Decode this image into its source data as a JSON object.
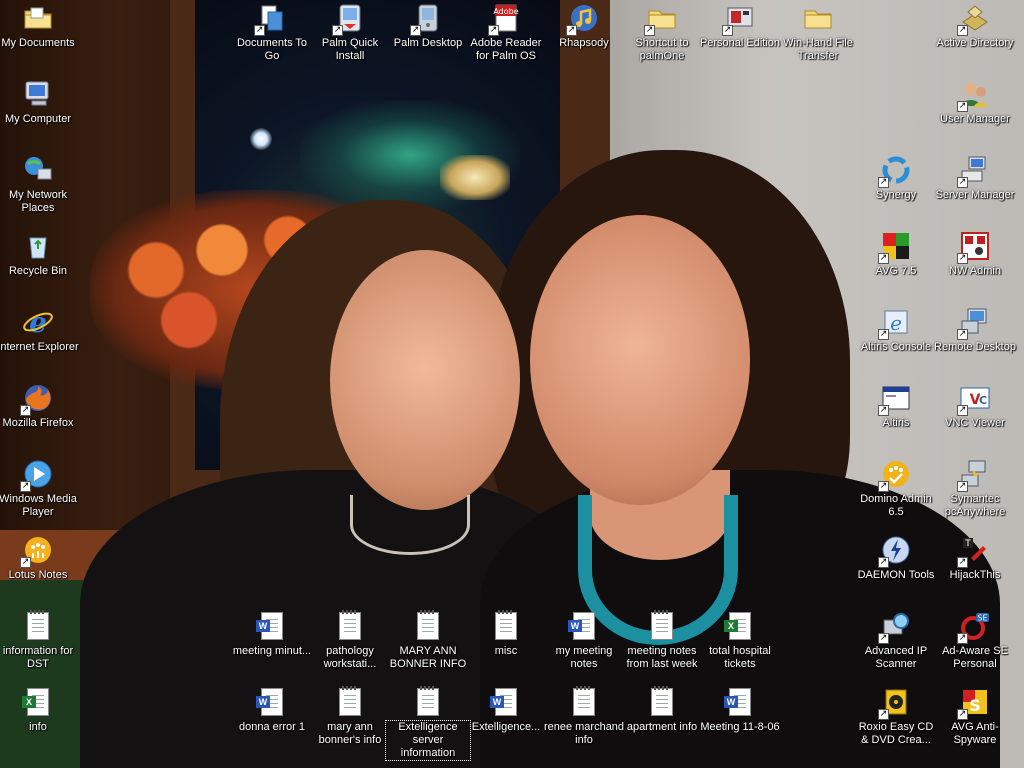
{
  "desktop": {
    "icons": [
      {
        "id": "my-documents",
        "label": "My Documents",
        "icon": "folder-documents-icon",
        "shortcut": false,
        "selected": false
      },
      {
        "id": "my-computer",
        "label": "My Computer",
        "icon": "computer-icon",
        "shortcut": false,
        "selected": false
      },
      {
        "id": "my-network-places",
        "label": "My Network Places",
        "icon": "network-places-icon",
        "shortcut": false,
        "selected": false
      },
      {
        "id": "recycle-bin",
        "label": "Recycle Bin",
        "icon": "recycle-bin-icon",
        "shortcut": false,
        "selected": false
      },
      {
        "id": "internet-explorer",
        "label": "Internet Explorer",
        "icon": "internet-explorer-icon",
        "shortcut": false,
        "selected": false
      },
      {
        "id": "mozilla-firefox",
        "label": "Mozilla Firefox",
        "icon": "firefox-icon",
        "shortcut": true,
        "selected": false
      },
      {
        "id": "windows-media-player",
        "label": "Windows Media Player",
        "icon": "media-player-icon",
        "shortcut": true,
        "selected": false
      },
      {
        "id": "lotus-notes",
        "label": "Lotus Notes",
        "icon": "lotus-notes-icon",
        "shortcut": true,
        "selected": false
      },
      {
        "id": "information-for-dst",
        "label": "information for DST",
        "icon": "text-document-icon",
        "shortcut": false,
        "selected": false
      },
      {
        "id": "info",
        "label": "info",
        "icon": "excel-document-icon",
        "shortcut": false,
        "selected": false
      },
      {
        "id": "documents-to-go",
        "label": "Documents To Go",
        "icon": "documents-to-go-icon",
        "shortcut": true,
        "selected": false
      },
      {
        "id": "palm-quick-install",
        "label": "Palm Quick Install",
        "icon": "palm-install-icon",
        "shortcut": true,
        "selected": false
      },
      {
        "id": "palm-desktop",
        "label": "Palm Desktop",
        "icon": "palm-desktop-icon",
        "shortcut": true,
        "selected": false
      },
      {
        "id": "adobe-reader-palm",
        "label": "Adobe Reader for Palm OS",
        "icon": "adobe-reader-icon",
        "shortcut": true,
        "selected": false
      },
      {
        "id": "rhapsody",
        "label": "Rhapsody",
        "icon": "rhapsody-icon",
        "shortcut": true,
        "selected": false
      },
      {
        "id": "shortcut-to-palmone",
        "label": "Shortcut to palmOne",
        "icon": "folder-icon",
        "shortcut": true,
        "selected": false
      },
      {
        "id": "personal-edition",
        "label": "Personal Edition",
        "icon": "personal-edition-icon",
        "shortcut": true,
        "selected": false
      },
      {
        "id": "win-hand-file-transfer",
        "label": "Win-Hand File Transfer",
        "icon": "folder-icon",
        "shortcut": false,
        "selected": false
      },
      {
        "id": "active-directory",
        "label": "Active Directory",
        "icon": "active-directory-icon",
        "shortcut": true,
        "selected": false
      },
      {
        "id": "user-manager",
        "label": "User Manager",
        "icon": "user-manager-icon",
        "shortcut": true,
        "selected": false
      },
      {
        "id": "synergy",
        "label": "Synergy",
        "icon": "synergy-icon",
        "shortcut": true,
        "selected": false
      },
      {
        "id": "server-manager",
        "label": "Server Manager",
        "icon": "server-manager-icon",
        "shortcut": true,
        "selected": false
      },
      {
        "id": "avg-75",
        "label": "AVG 7.5",
        "icon": "avg-icon",
        "shortcut": true,
        "selected": false
      },
      {
        "id": "nw-admin",
        "label": "NW Admin",
        "icon": "nw-admin-icon",
        "shortcut": true,
        "selected": false
      },
      {
        "id": "altiris-console",
        "label": "Altiris Console",
        "icon": "altiris-console-icon",
        "shortcut": true,
        "selected": false
      },
      {
        "id": "remote-desktop",
        "label": "Remote Desktop",
        "icon": "remote-desktop-icon",
        "shortcut": true,
        "selected": false
      },
      {
        "id": "altiris",
        "label": "Altiris",
        "icon": "altiris-window-icon",
        "shortcut": true,
        "selected": false
      },
      {
        "id": "vnc-viewer",
        "label": "VNC Viewer",
        "icon": "vnc-viewer-icon",
        "shortcut": true,
        "selected": false
      },
      {
        "id": "domino-admin",
        "label": "Domino Admin 6.5",
        "icon": "domino-admin-icon",
        "shortcut": true,
        "selected": false
      },
      {
        "id": "symantec-pcanywhere",
        "label": "Symantec pcAnywhere",
        "icon": "pcanywhere-icon",
        "shortcut": true,
        "selected": false
      },
      {
        "id": "daemon-tools",
        "label": "DAEMON Tools",
        "icon": "daemon-tools-icon",
        "shortcut": true,
        "selected": false
      },
      {
        "id": "hijackthis",
        "label": "HijackThis",
        "icon": "hijackthis-icon",
        "shortcut": true,
        "selected": false
      },
      {
        "id": "advanced-ip-scanner",
        "label": "Advanced IP Scanner",
        "icon": "ip-scanner-icon",
        "shortcut": true,
        "selected": false
      },
      {
        "id": "ad-aware",
        "label": "Ad-Aware SE Personal",
        "icon": "ad-aware-icon",
        "shortcut": true,
        "selected": false
      },
      {
        "id": "roxio-easy-cd",
        "label": "Roxio Easy CD & DVD Crea...",
        "icon": "roxio-icon",
        "shortcut": true,
        "selected": false
      },
      {
        "id": "avg-anti-spyware",
        "label": "AVG Anti-Spyware",
        "icon": "avg-anti-spyware-icon",
        "shortcut": true,
        "selected": false
      },
      {
        "id": "meeting-minut",
        "label": "meeting minut...",
        "icon": "word-document-icon",
        "shortcut": false,
        "selected": false
      },
      {
        "id": "pathology-workstati",
        "label": "pathology workstati...",
        "icon": "text-document-icon",
        "shortcut": false,
        "selected": false
      },
      {
        "id": "mary-ann-bonner-info",
        "label": "MARY ANN BONNER INFO",
        "icon": "text-document-icon",
        "shortcut": false,
        "selected": false
      },
      {
        "id": "misc",
        "label": "misc",
        "icon": "text-document-icon",
        "shortcut": false,
        "selected": false
      },
      {
        "id": "my-meeting-notes",
        "label": "my meeting notes",
        "icon": "word-document-icon",
        "shortcut": false,
        "selected": false
      },
      {
        "id": "meeting-notes-last-week",
        "label": "meeting notes from last week",
        "icon": "text-document-icon",
        "shortcut": false,
        "selected": false
      },
      {
        "id": "total-hospital-tickets",
        "label": "total hospital tickets",
        "icon": "excel-document-icon",
        "shortcut": false,
        "selected": false
      },
      {
        "id": "donna-error-1",
        "label": "donna error 1",
        "icon": "word-document-icon",
        "shortcut": false,
        "selected": false
      },
      {
        "id": "mary-anns-info",
        "label": "mary ann bonner's info",
        "icon": "text-document-icon",
        "shortcut": false,
        "selected": false
      },
      {
        "id": "extelligence-server-information",
        "label": "Extelligence server information",
        "icon": "text-document-icon",
        "shortcut": false,
        "selected": true
      },
      {
        "id": "extelligence",
        "label": "Extelligence...",
        "icon": "word-document-icon",
        "shortcut": false,
        "selected": false
      },
      {
        "id": "renee-marchand-info",
        "label": "renee marchand info",
        "icon": "text-document-icon",
        "shortcut": false,
        "selected": false
      },
      {
        "id": "apartment-info",
        "label": "apartment info",
        "icon": "text-document-icon",
        "shortcut": false,
        "selected": false
      },
      {
        "id": "meeting-11-8-06",
        "label": "Meeting 11-8-06",
        "icon": "word-document-icon",
        "shortcut": false,
        "selected": false
      }
    ]
  },
  "colors": {
    "label_text": "#ffffff",
    "word": "#2b55b8",
    "excel": "#1f7a34",
    "folder": "#f2d675",
    "firefox": "#e8761e",
    "ie": "#2a7de1",
    "necklace": "#1c8fa0"
  }
}
